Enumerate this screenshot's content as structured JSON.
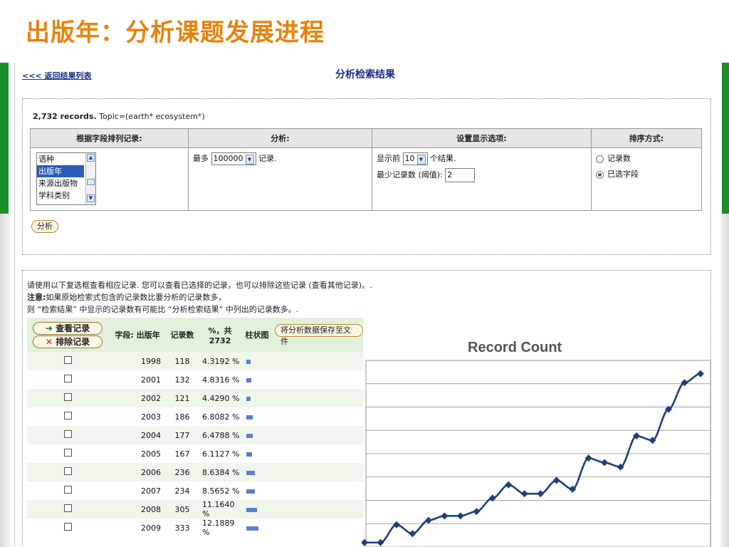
{
  "slide": {
    "title": "出版年：分析课题发展进程"
  },
  "page": {
    "back_link": "<<< 返回结果列表",
    "heading": "分析检索结果",
    "records_count": "2,732 records.",
    "query": "Topic=(earth* ecosystem*)"
  },
  "options": {
    "headers": [
      "根据字段排列记录:",
      "分析:",
      "设置显示选项:",
      "排序方式:"
    ],
    "field_list": [
      "语种",
      "出版年",
      "来源出版物",
      "学科类别"
    ],
    "field_selected_index": 1,
    "analyze_prefix": "最多",
    "max_records": "100000",
    "analyze_suffix": "记录.",
    "show_prefix": "显示前",
    "show_count": "10",
    "show_suffix": "个结果.",
    "min_label": "最少记录数 (阈值):",
    "min_value": "2",
    "sort_by_count": "记录数",
    "sort_by_field": "已选字段",
    "sort_selected": "field",
    "analyze_button": "分析"
  },
  "instructions": {
    "line1": "请使用以下复选框查看相应记录. 您可以查看已选择的记录，也可以排除这些记录 (查看其他记录)。.",
    "note_label": "注意:",
    "line2": "如果原始检索式包含的记录数比要分析的记录数多，",
    "line3": "则 “检索结果” 中显示的记录数有可能比 “分析检索结果” 中列出的记录数多。."
  },
  "results": {
    "view_button": "查看记录",
    "exclude_button": "排除记录",
    "field_header": "字段: 出版年",
    "count_header": "记录数",
    "percent_header": "%，共 2732",
    "bar_header": "柱状图",
    "save_button": "将分析数据保存至文件",
    "rows": [
      {
        "year": "1998",
        "count": "118",
        "percent": "4.3192 %",
        "bar": 4.3192
      },
      {
        "year": "2001",
        "count": "132",
        "percent": "4.8316 %",
        "bar": 4.8316
      },
      {
        "year": "2002",
        "count": "121",
        "percent": "4.4290 %",
        "bar": 4.429
      },
      {
        "year": "2003",
        "count": "186",
        "percent": "6.8082 %",
        "bar": 6.8082
      },
      {
        "year": "2004",
        "count": "177",
        "percent": "6.4788 %",
        "bar": 6.4788
      },
      {
        "year": "2005",
        "count": "167",
        "percent": "6.1127 %",
        "bar": 6.1127
      },
      {
        "year": "2006",
        "count": "236",
        "percent": "8.6384 %",
        "bar": 8.6384
      },
      {
        "year": "2007",
        "count": "234",
        "percent": "8.5652 %",
        "bar": 8.5652
      },
      {
        "year": "2008",
        "count": "305",
        "percent": "11.1640 %",
        "bar": 11.164
      },
      {
        "year": "2009",
        "count": "333",
        "percent": "12.1889 %",
        "bar": 12.1889
      }
    ]
  },
  "colors": {
    "title": "#e8820c",
    "green": "#1a8f2a",
    "line": "#1f3f7a",
    "link": "#1a2b8c"
  },
  "chart_data": {
    "type": "line",
    "title": "Record Count",
    "series": [
      {
        "values": [
          1,
          1,
          5,
          3,
          6,
          7,
          7,
          8,
          11,
          14,
          12,
          12,
          15,
          13,
          20,
          19,
          18,
          25,
          24,
          31,
          37,
          39
        ]
      }
    ],
    "ylim": [
      0,
      42
    ],
    "grid": true
  }
}
